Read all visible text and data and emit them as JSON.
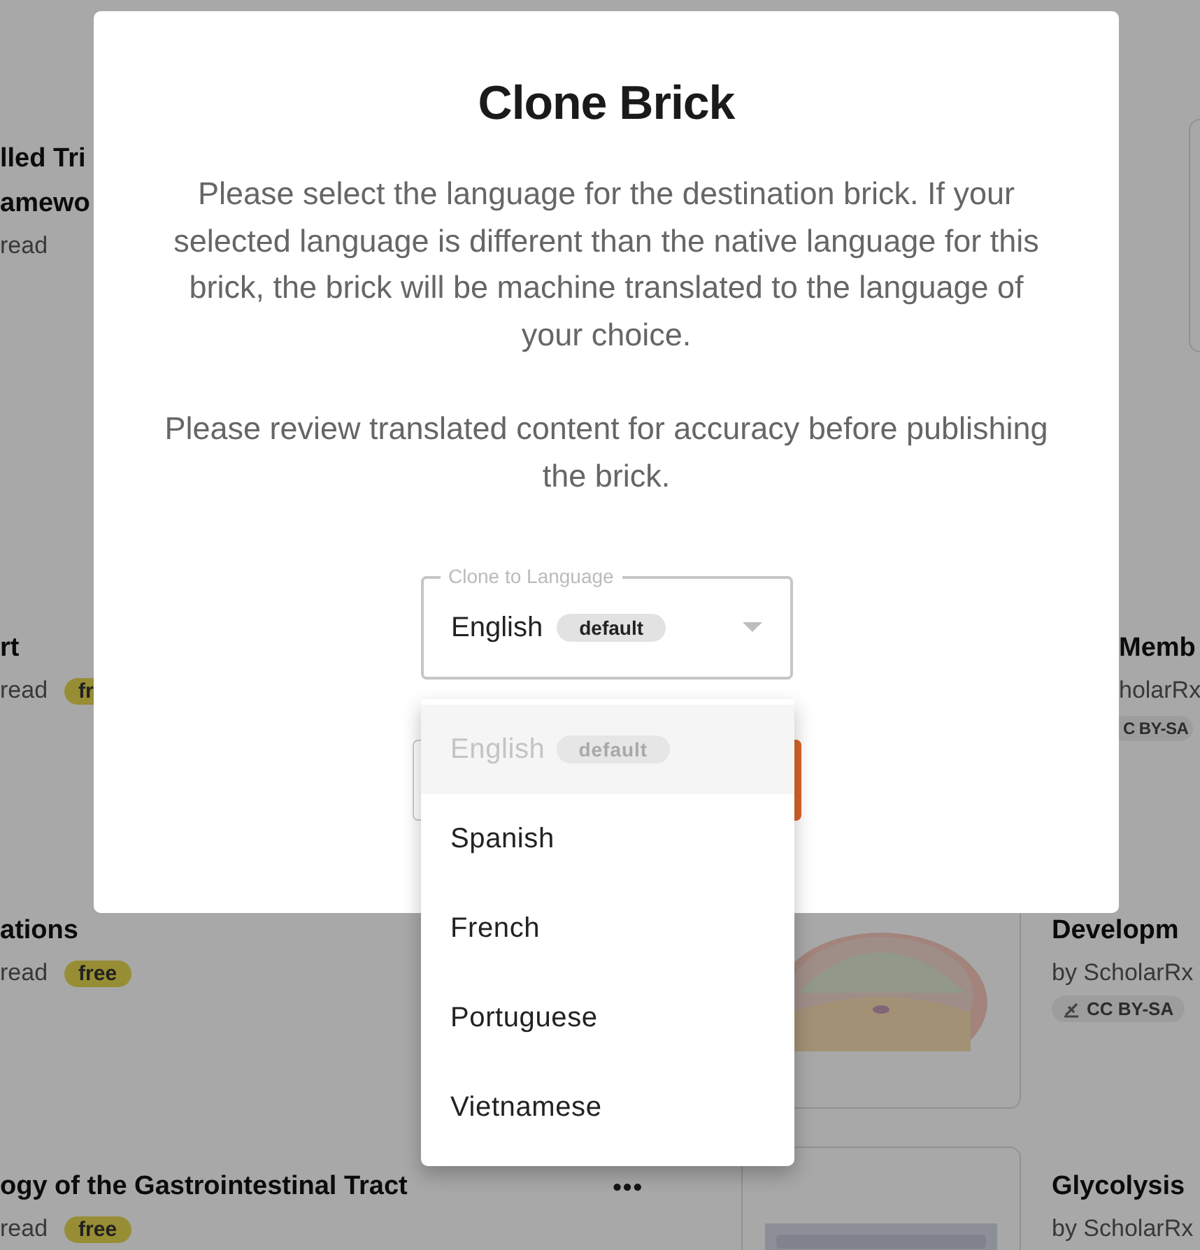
{
  "background": {
    "left_cards": [
      {
        "title_lines": [
          "lled Tri",
          "amewo"
        ],
        "meta": "read"
      },
      {
        "title_lines": [
          "rt"
        ],
        "meta": "read",
        "badge": "fr"
      },
      {
        "title_lines": [
          "ations"
        ],
        "meta": "read",
        "badge": "free"
      },
      {
        "title_lines": [
          "ogy of the Gastrointestinal Tract"
        ],
        "meta": "read",
        "badge": "free",
        "menu": "•••"
      }
    ],
    "right_cards": [
      {
        "kind": "thumbnail"
      },
      {
        "kind": "text",
        "title": "Memb",
        "meta": "holarRx",
        "license": "C BY-SA"
      },
      {
        "kind": "text",
        "title": "Developm",
        "meta": "by ScholarRx",
        "license": "CC BY-SA"
      },
      {
        "kind": "text",
        "title": "Glycolysis",
        "meta": "by ScholarRx"
      }
    ]
  },
  "dialog": {
    "title": "Clone Brick",
    "paragraphs": [
      "Please select the language for the destination brick. If your selected language is different than the native language for this brick, the brick will be machine translated to the language of your choice.",
      "Please review translated content for accuracy before publishing the brick."
    ],
    "select": {
      "label": "Clone to Language",
      "value": "English",
      "badge": "default",
      "expanded": true
    },
    "options": [
      {
        "label": "English",
        "badge": "default",
        "disabled": true
      },
      {
        "label": "Spanish",
        "disabled": false
      },
      {
        "label": "French",
        "disabled": false
      },
      {
        "label": "Portuguese",
        "disabled": false
      },
      {
        "label": "Vietnamese",
        "disabled": false
      }
    ]
  }
}
